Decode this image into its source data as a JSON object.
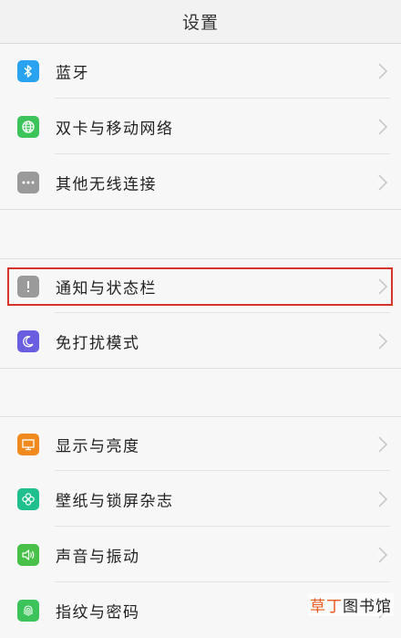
{
  "header": {
    "title": "设置"
  },
  "colors": {
    "accent_highlight": "#d9342b",
    "bluetooth": "#29a3f0",
    "dual_sim": "#3cc35a",
    "other_wireless": "#9a9a9a",
    "notification": "#9a9a9a",
    "dnd": "#6a5ee0",
    "display": "#f08a1e",
    "wallpaper": "#1fbf8e",
    "sound": "#48c04a",
    "fingerprint": "#3cc35a"
  },
  "settings": {
    "items": [
      {
        "label": "蓝牙",
        "icon": "bluetooth-icon"
      },
      {
        "label": "双卡与移动网络",
        "icon": "globe-icon"
      },
      {
        "label": "其他无线连接",
        "icon": "more-dots-icon"
      },
      {
        "label": "通知与状态栏",
        "icon": "exclamation-icon",
        "highlighted": true
      },
      {
        "label": "免打扰模式",
        "icon": "moon-icon"
      },
      {
        "label": "显示与亮度",
        "icon": "monitor-icon"
      },
      {
        "label": "壁纸与锁屏杂志",
        "icon": "flower-icon"
      },
      {
        "label": "声音与振动",
        "icon": "speaker-icon"
      },
      {
        "label": "指纹与密码",
        "icon": "fingerprint-icon"
      }
    ]
  },
  "watermark": {
    "accent": "草丁",
    "rest": "图书馆"
  }
}
